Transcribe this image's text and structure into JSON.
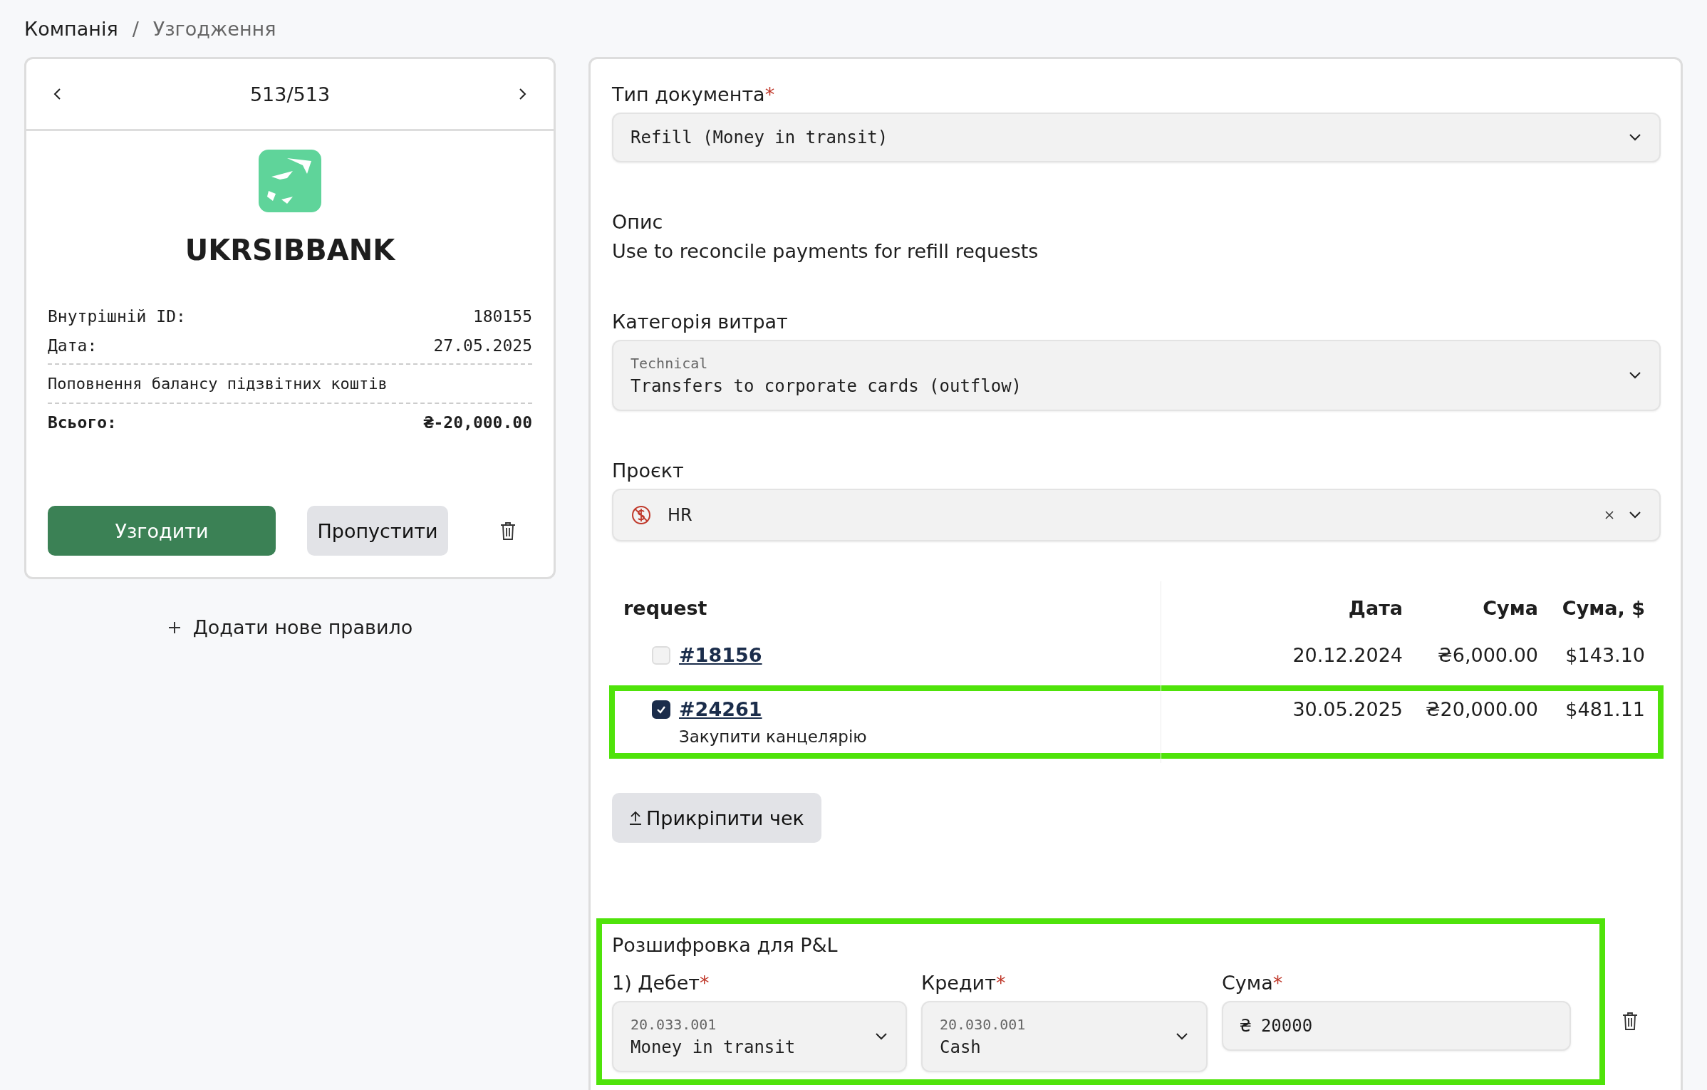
{
  "breadcrumb": {
    "separator": "/",
    "items": [
      {
        "label": "Компанія",
        "current": false
      },
      {
        "label": "Узгодження",
        "current": true
      }
    ]
  },
  "transaction_card": {
    "pager": "513/513",
    "bank_name": "UKRSIBBANK",
    "details": [
      {
        "label": "Внутрішній ID:",
        "value": "180155"
      },
      {
        "label": "Дата:",
        "value": "27.05.2025"
      }
    ],
    "description": "Поповнення балансу підзвітних коштів",
    "total": {
      "label": "Всього:",
      "value": "₴-20,000.00"
    },
    "approve_button": "Узгодити",
    "skip_button": "Пропустити"
  },
  "add_rule_link": "Додати нове правило",
  "form": {
    "document_type": {
      "label": "Тип документа",
      "required_mark": "*",
      "value": "Refill (Money in transit)"
    },
    "description": {
      "label": "Опис",
      "text": "Use to reconcile payments for refill requests"
    },
    "expense_category": {
      "label": "Категорія витрат",
      "group": "Technical",
      "value": "Transfers to corporate cards (outflow)"
    },
    "project": {
      "label": "Проєкт",
      "value": "HR"
    },
    "requests": {
      "columns": [
        "request",
        "Дата",
        "Сума",
        "Сума, $"
      ],
      "rows": [
        {
          "link": "#18156",
          "checked": false,
          "highlighted": false,
          "date": "20.12.2024",
          "amount": "₴6,000.00",
          "amount_usd": "$143.10"
        },
        {
          "link": "#24261",
          "note": "Закупити канцелярію",
          "checked": true,
          "highlighted": true,
          "date": "30.05.2025",
          "amount": "₴20,000.00",
          "amount_usd": "$481.11"
        }
      ]
    },
    "attach_button": "Прикріпити чек",
    "pl_breakdown": {
      "title": "Розшифровка для P&L",
      "highlighted": true,
      "entries": [
        {
          "debit": {
            "label": "1) Дебет",
            "required_mark": "*",
            "code": "20.033.001",
            "name": "Money in transit"
          },
          "credit": {
            "label": "Кредит",
            "required_mark": "*",
            "code": "20.030.001",
            "name": "Cash"
          },
          "amount": {
            "label": "Сума",
            "required_mark": "*",
            "currency": "₴",
            "value": "20000"
          }
        }
      ]
    }
  }
}
